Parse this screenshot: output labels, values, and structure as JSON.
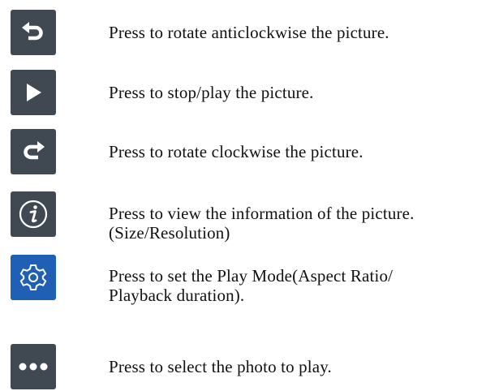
{
  "colors": {
    "button_bg": "#404952",
    "button_active_bg": "#1f5fb4",
    "icon_fg": "#ffffff"
  },
  "items": [
    {
      "icon": "rotate-anticlockwise-icon",
      "lines": [
        "Press to rotate anticlockwise the picture."
      ]
    },
    {
      "icon": "play-icon",
      "lines": [
        "Press to stop/play the picture."
      ]
    },
    {
      "icon": "rotate-clockwise-icon",
      "lines": [
        "Press to rotate clockwise the picture."
      ]
    },
    {
      "icon": "info-icon",
      "lines": [
        "Press to view the information of the picture.",
        "(Size/Resolution)"
      ]
    },
    {
      "icon": "gear-icon",
      "lines": [
        "Press to set the Play Mode(Aspect Ratio/",
        "Playback duration)."
      ]
    },
    {
      "icon": "more-dots-icon",
      "lines": [
        "Press to select the photo to play."
      ]
    }
  ]
}
